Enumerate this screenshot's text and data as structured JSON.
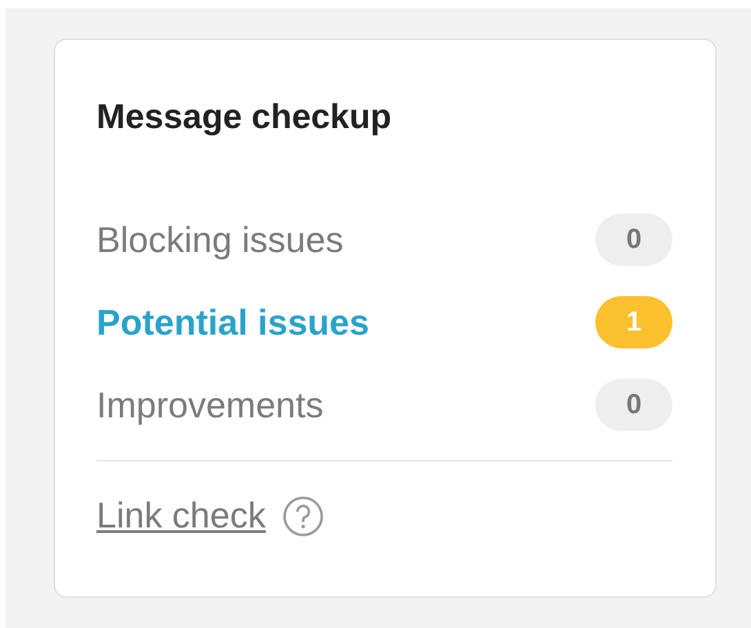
{
  "card": {
    "title": "Message checkup",
    "issues": [
      {
        "label": "Blocking issues",
        "count": "0",
        "selected": false,
        "color": "#eeeeee"
      },
      {
        "label": "Potential issues",
        "count": "1",
        "selected": true,
        "color": "#fbc02d"
      },
      {
        "label": "Improvements",
        "count": "0",
        "selected": false,
        "color": "#eeeeee"
      }
    ],
    "link": {
      "label": "Link check"
    }
  }
}
